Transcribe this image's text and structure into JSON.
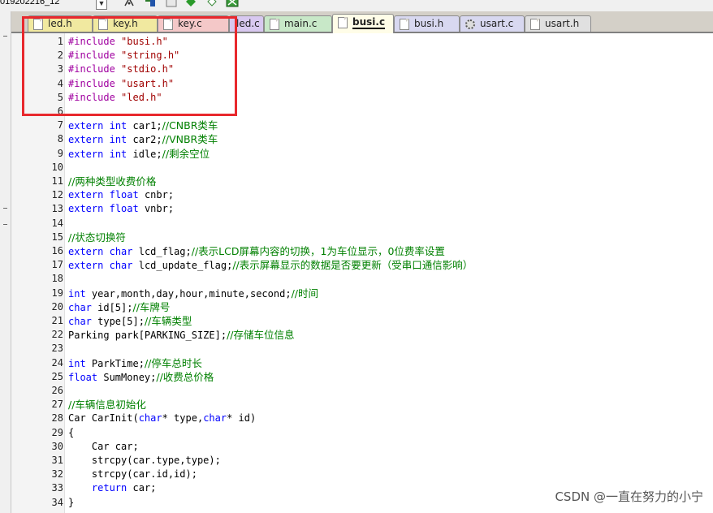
{
  "toolbar": {
    "target_name": "019202216_12",
    "icons": [
      "dropdown-arrow-icon",
      "manage-components-icon",
      "file-extensions-icon",
      "pack-installer-icon",
      "green-diamond-icon",
      "batch-build-icon"
    ]
  },
  "tabs": [
    {
      "label": "led.h",
      "color": "#f1e9a0"
    },
    {
      "label": "key.h",
      "color": "#f1e9a0"
    },
    {
      "label": "key.c",
      "color": "#f4c8c8"
    },
    {
      "label": "led.c",
      "color": "#d8c8f0"
    },
    {
      "label": "main.c",
      "color": "#c8e8c8"
    },
    {
      "label": "busi.c",
      "color": "#fffde8",
      "active": true
    },
    {
      "label": "busi.h",
      "color": "#d8d8f0"
    },
    {
      "label": "usart.c",
      "color": "#d8d8f0"
    },
    {
      "label": "usart.h",
      "color": "#e0e0e0"
    }
  ],
  "editor": {
    "file": "busi.c",
    "lines": [
      {
        "n": "1",
        "html": "<span class=\"pp\">#include</span> <span class=\"str\">\"busi.h\"</span>"
      },
      {
        "n": "2",
        "html": "<span class=\"pp\">#include</span> <span class=\"str\">\"string.h\"</span>"
      },
      {
        "n": "3",
        "html": "<span class=\"pp\">#include</span> <span class=\"str\">\"stdio.h\"</span>"
      },
      {
        "n": "4",
        "html": "<span class=\"pp\">#include</span> <span class=\"str\">\"usart.h\"</span>"
      },
      {
        "n": "5",
        "html": "<span class=\"pp\">#include</span> <span class=\"str\">\"led.h\"</span>"
      },
      {
        "n": "6",
        "html": ""
      },
      {
        "n": "7",
        "html": "<span class=\"kw\">extern</span> <span class=\"kw\">int</span> car1;<span class=\"cm\">//CNBR类车</span>"
      },
      {
        "n": "8",
        "html": "<span class=\"kw\">extern</span> <span class=\"kw\">int</span> car2;<span class=\"cm\">//VNBR类车</span>"
      },
      {
        "n": "9",
        "html": "<span class=\"kw\">extern</span> <span class=\"kw\">int</span> idle;<span class=\"cm\">//剩余空位</span>"
      },
      {
        "n": "10",
        "html": ""
      },
      {
        "n": "11",
        "html": "<span class=\"cm\">//两种类型收费价格</span>"
      },
      {
        "n": "12",
        "html": "<span class=\"kw\">extern</span> <span class=\"kw\">float</span> cnbr;"
      },
      {
        "n": "13",
        "html": "<span class=\"kw\">extern</span> <span class=\"kw\">float</span> vnbr;"
      },
      {
        "n": "14",
        "html": ""
      },
      {
        "n": "15",
        "html": "<span class=\"cm\">//状态切换符</span>"
      },
      {
        "n": "16",
        "html": "<span class=\"kw\">extern</span> <span class=\"kw\">char</span> lcd_flag;<span class=\"cm\">//表示LCD屏幕内容的切换，1为车位显示，0位费率设置</span>"
      },
      {
        "n": "17",
        "html": "<span class=\"kw\">extern</span> <span class=\"kw\">char</span> lcd_update_flag;<span class=\"cm\">//表示屏幕显示的数据是否要更新（受串口通信影响）</span>"
      },
      {
        "n": "18",
        "html": ""
      },
      {
        "n": "19",
        "html": "<span class=\"kw\">int</span> year,month,day,hour,minute,second;<span class=\"cm\">//时间</span>"
      },
      {
        "n": "20",
        "html": "<span class=\"kw\">char</span> id[5];<span class=\"cm\">//车牌号</span>"
      },
      {
        "n": "21",
        "html": "<span class=\"kw\">char</span> type[5];<span class=\"cm\">//车辆类型</span>"
      },
      {
        "n": "22",
        "html": "Parking park[PARKING_SIZE];<span class=\"cm\">//存储车位信息</span>"
      },
      {
        "n": "23",
        "html": ""
      },
      {
        "n": "24",
        "html": "<span class=\"kw\">int</span> ParkTime;<span class=\"cm\">//停车总时长</span>"
      },
      {
        "n": "25",
        "html": "<span class=\"kw\">float</span> SumMoney;<span class=\"cm\">//收费总价格</span>"
      },
      {
        "n": "26",
        "html": ""
      },
      {
        "n": "27",
        "html": "<span class=\"cm\">//车辆信息初始化</span>"
      },
      {
        "n": "28",
        "html": "Car CarInit(<span class=\"kw\">char</span>* type,<span class=\"kw\">char</span>* id)"
      },
      {
        "n": "29",
        "html": "{"
      },
      {
        "n": "30",
        "html": "    Car car;"
      },
      {
        "n": "31",
        "html": "    strcpy(car.type,type);"
      },
      {
        "n": "32",
        "html": "    strcpy(car.id,id);"
      },
      {
        "n": "33",
        "html": "    <span class=\"kw\">return</span> car;"
      },
      {
        "n": "34",
        "html": "}"
      }
    ]
  },
  "watermark": "CSDN @一直在努力的小宁"
}
